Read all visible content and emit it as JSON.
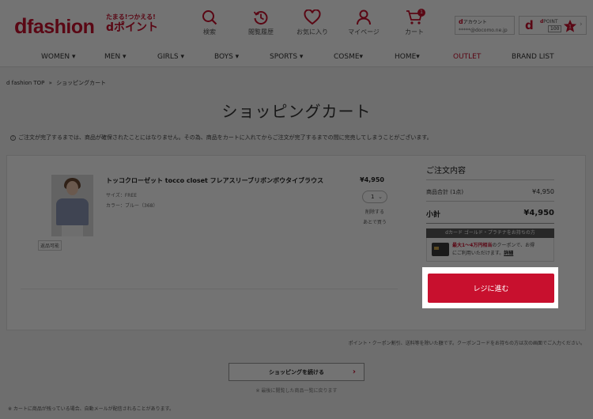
{
  "header": {
    "logo_d": "d",
    "logo_text": "fashion",
    "tamaru_line1": "たまる!つかえる!",
    "tamaru_line2": "dポイント",
    "search_label": "検索",
    "history_label": "閲覧履歴",
    "favorites_label": "お気に入り",
    "mypage_label": "マイページ",
    "cart_label": "カート",
    "cart_count": "1",
    "account_label": "アカウント",
    "account_id": "*****@docomo.ne.jp",
    "point_label": "POINT",
    "point_value": "100",
    "rank_value": "1"
  },
  "nav": {
    "items": [
      "WOMEN ▾",
      "MEN ▾",
      "GIRLS ▾",
      "BOYS ▾",
      "SPORTS ▾",
      "COSME▾",
      "HOME▾",
      "OUTLET",
      "BRAND LIST"
    ]
  },
  "breadcrumb": {
    "home": "d fashion TOP",
    "sep": "»",
    "current": "ショッピングカート"
  },
  "page_title": "ショッピングカート",
  "notice": "ご注文が完了するまでは、商品が確保されたことにはなりません。その為、商品をカートに入れてからご注文が完了するまでの間に完売してしまうことがございます。",
  "item": {
    "name": "トッコクローゼット tocco closet フレアスリーブリボンボウタイブラウス",
    "size": "サイズ：FREE",
    "color": "カラー：ブルー（368）",
    "price": "¥4,950",
    "quantity": "1",
    "stock_tag": "返品可能",
    "remove_label": "削除する",
    "later_label": "あとで買う"
  },
  "summary": {
    "title": "ご注文内容",
    "subtotal_label": "商品合計 (1点)",
    "subtotal_value": "¥4,950",
    "total_label": "小計",
    "total_value": "¥4,950",
    "card_bar": "dカード ゴールド・プラチナをお持ちの方",
    "card_line1_em": "最大1〜4万円相当",
    "card_line1_rest": "のクーポンで、お得",
    "card_line2": "にご利用いただけます。",
    "card_link": "詳細"
  },
  "checkout_label": "レジに進む",
  "fine_print": "ポイント・クーポン割引、送料等を除いた額です。クーポンコードをお持ちの方は次の画面でご入力ください。",
  "continue_label": "ショッピングを続ける",
  "continue_arrow": "›",
  "recent_text": "※ 最後に閲覧した商品一覧に戻ります",
  "footnote": "※ カートに商品が残っている場合、自動メールが配信されることがあります。",
  "colors": {
    "brand": "#c8102e",
    "overlay": "rgba(0,0,0,0.55)"
  }
}
